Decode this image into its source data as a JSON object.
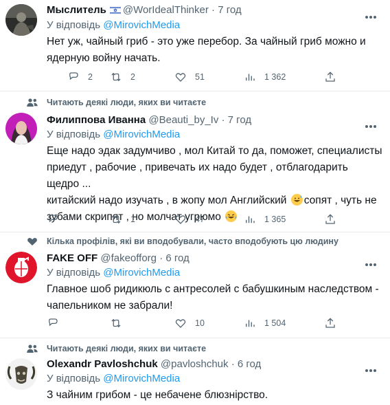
{
  "tweets": [
    {
      "social_context": "",
      "author": "Мыслитель",
      "handle": "@WorIdealThinker",
      "separator": "·",
      "time": "7 год",
      "reply_prefix": "У відповідь",
      "reply_mention": "@MirovichMedia",
      "text_lines": [
        "Нет уж, чайный гриб - это уже перебор. За чайный гриб можно и",
        "ядерную войну начать."
      ],
      "stats": {
        "replies": "2",
        "retweets": "2",
        "likes": "51",
        "views": "1 362"
      }
    },
    {
      "social_context": "Читають деякі люди, яких ви читаєте",
      "author": "Филиппова Иванна",
      "handle": "@Beauti_by_Iv",
      "separator": "·",
      "time": "7 год",
      "reply_prefix": "У відповідь",
      "reply_mention": "@MirovichMedia",
      "text_lines": [
        "Еще надо эдак задумчиво , мол Китай то да, поможет, специалисты",
        "приедут , рабочие , привечать их надо будет , отблагодарить щедро ...",
        "китайский надо изучать , в жопу мол Английский",
        "сопят , чуть не",
        "зубами скрипят , но молчат угрюмо"
      ],
      "stats": {
        "replies": "",
        "retweets": "1",
        "likes": "47",
        "views": "1 365"
      }
    },
    {
      "social_context": "Кілька профілів, які ви вподобували, часто вподобують цю людину",
      "author": "FAKE OFF",
      "handle": "@fakeofforg",
      "separator": "·",
      "time": "6 год",
      "reply_prefix": "У відповідь",
      "reply_mention": "@MirovichMedia",
      "text_lines": [
        "Главное шоб ридикюль с антресолей с бабушкиным наследством -",
        "чапельником не забрали!"
      ],
      "stats": {
        "replies": "",
        "retweets": "",
        "likes": "10",
        "views": "1 504"
      }
    },
    {
      "social_context": "Читають деякі люди, яких ви читаєте",
      "author": "Olexandr Pavloshchuk",
      "handle": "@pavloshchuk",
      "separator": "·",
      "time": "6 год",
      "reply_prefix": "У відповідь",
      "reply_mention": "@MirovichMedia",
      "text_lines": [
        "З чайним грибом - це небачене блюзнірство."
      ],
      "stats": {
        "replies": "",
        "retweets": "",
        "likes": "",
        "views": ""
      }
    }
  ],
  "icons": {
    "reply": "comment-icon",
    "retweet": "retweet-icon",
    "like": "heart-icon",
    "views": "views-bar-chart-icon",
    "share": "share-icon",
    "more": "more-dots-icon",
    "social_people": "people-icon",
    "social_heart": "heart-filled-icon",
    "flag": "israel-flag-icon",
    "emoji_sweat": "grinning-sweat-emoji",
    "emoji_cry": "crying-laughing-emoji"
  },
  "colors": {
    "link": "#1d9bf0",
    "secondary": "#536471",
    "text": "#0f1419",
    "divider": "#e6ecf0"
  }
}
